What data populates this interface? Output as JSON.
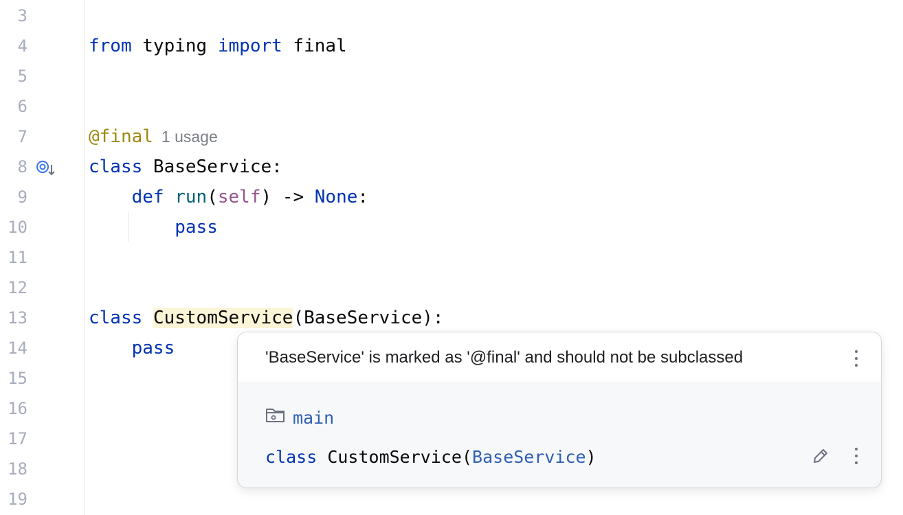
{
  "editor": {
    "lines": [
      {
        "num": "3",
        "parts": []
      },
      {
        "num": "4",
        "parts": [
          {
            "t": "from",
            "c": "kw"
          },
          {
            "t": " typing ",
            "c": ""
          },
          {
            "t": "import",
            "c": "kw"
          },
          {
            "t": " final",
            "c": ""
          }
        ]
      },
      {
        "num": "5",
        "parts": []
      },
      {
        "num": "6",
        "parts": []
      },
      {
        "num": "7",
        "parts": [
          {
            "t": "@final",
            "c": "deco"
          }
        ]
      },
      {
        "num": "8",
        "parts": [
          {
            "t": "class",
            "c": "kw"
          },
          {
            "t": " BaseService:",
            "c": ""
          }
        ]
      },
      {
        "num": "9",
        "parts": [
          {
            "t": "    ",
            "c": ""
          },
          {
            "t": "def",
            "c": "kw"
          },
          {
            "t": " ",
            "c": ""
          },
          {
            "t": "run",
            "c": "fn"
          },
          {
            "t": "(",
            "c": ""
          },
          {
            "t": "self",
            "c": "self"
          },
          {
            "t": ") -> ",
            "c": ""
          },
          {
            "t": "None",
            "c": "kw"
          },
          {
            "t": ":",
            "c": ""
          }
        ]
      },
      {
        "num": "10",
        "parts": [
          {
            "t": "        ",
            "c": ""
          },
          {
            "t": "pass",
            "c": "kw"
          }
        ]
      },
      {
        "num": "11",
        "parts": []
      },
      {
        "num": "12",
        "parts": []
      },
      {
        "num": "13",
        "parts": [
          {
            "t": "class",
            "c": "kw"
          },
          {
            "t": " ",
            "c": ""
          },
          {
            "t": "CustomService",
            "c": "hl"
          },
          {
            "t": "(BaseService):",
            "c": ""
          }
        ]
      },
      {
        "num": "14",
        "parts": [
          {
            "t": "    ",
            "c": ""
          },
          {
            "t": "pass",
            "c": "kw"
          }
        ]
      },
      {
        "num": "15",
        "parts": []
      },
      {
        "num": "16",
        "parts": []
      },
      {
        "num": "17",
        "parts": []
      },
      {
        "num": "18",
        "parts": []
      },
      {
        "num": "19",
        "parts": []
      }
    ],
    "usage_hint": "1 usage",
    "gutter_icon": "implemented-overrides-down-arrow-icon"
  },
  "popup": {
    "message": "'BaseService' is marked as '@final' and should not be subclassed",
    "module_icon": "module-folder-icon",
    "module_name": "main",
    "fix_keyword": "class",
    "fix_name": " CustomService(",
    "fix_base": "BaseService",
    "fix_close": ")",
    "edit_icon": "pencil-icon",
    "more_icon": "vertical-ellipsis-icon"
  },
  "colors": {
    "keyword": "#0033b3",
    "function": "#00627a",
    "self": "#94558d",
    "decorator": "#9e880d",
    "highlight": "#fcf4d6",
    "link": "#2f5fb3",
    "line_number": "#a8adbd"
  }
}
